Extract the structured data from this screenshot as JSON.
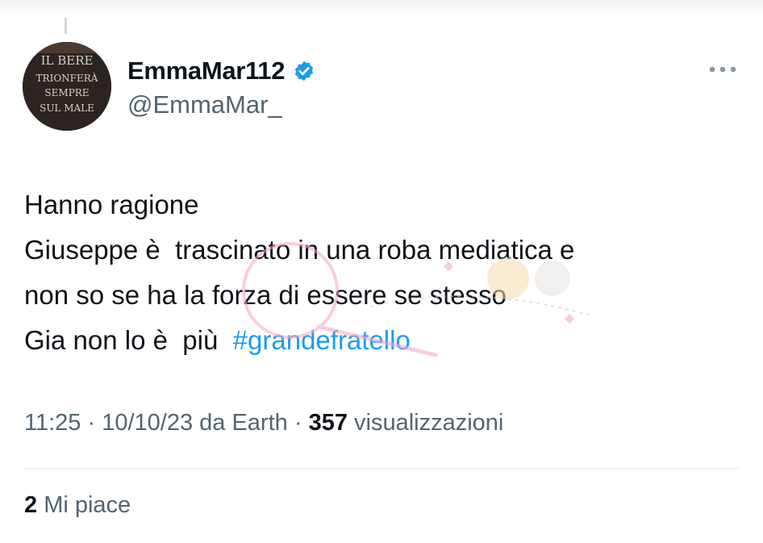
{
  "tweet": {
    "display_name": "EmmaMar112",
    "handle": "@EmmaMar_",
    "avatar_text": [
      "IL BERE",
      "TRIONFERÀ",
      "SEMPRE",
      "SUL MALE"
    ],
    "text_lines": [
      "Hanno ragione",
      "Giuseppe è  trascinato in una roba mediatica e",
      "non so se ha la forza di essere se stesso",
      "Gia non lo è  più  "
    ],
    "hashtag": "#grandefratello",
    "meta": {
      "time": "11:25",
      "sep1": " · ",
      "date": "10/10/23",
      "source": " da Earth",
      "sep2": " · ",
      "views_count": "357",
      "views_label": " visualizzazioni"
    },
    "likes": {
      "count": "2",
      "label": " Mi piace"
    }
  },
  "colors": {
    "link": "#1d9bf0",
    "secondary_text": "#536471",
    "primary_text": "#0f1419",
    "divider": "#e1e8ed",
    "verified_badge": "#1d9bf0"
  },
  "icons": {
    "verified": "verified-badge-icon",
    "more": "more-dots-icon"
  }
}
